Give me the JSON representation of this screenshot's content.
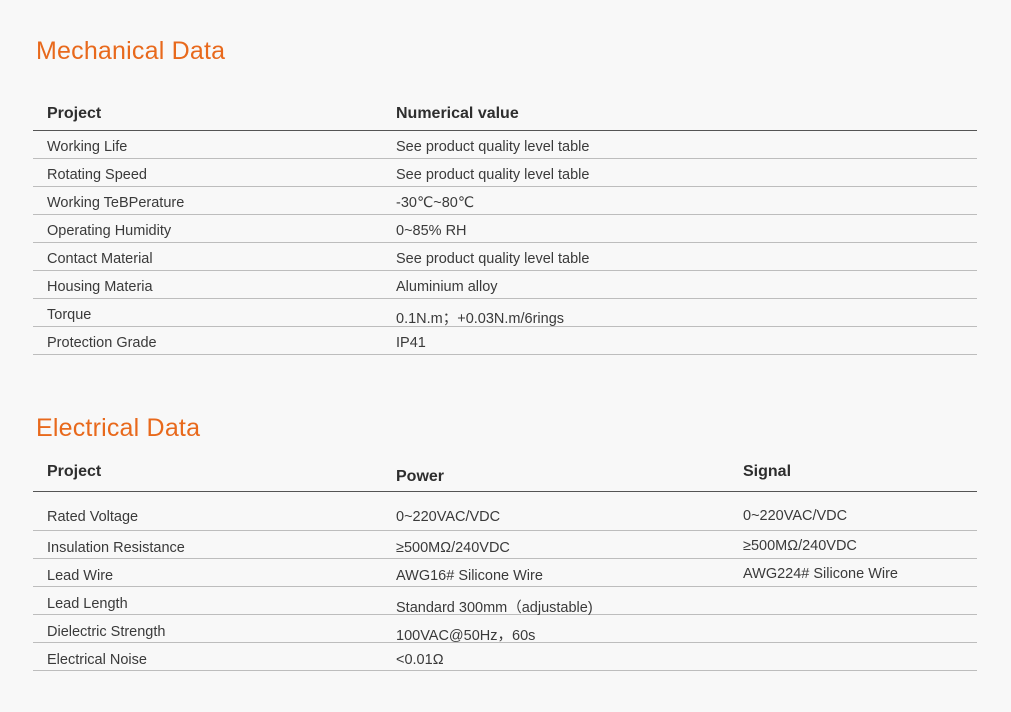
{
  "mechanical": {
    "title": "Mechanical Data",
    "headers": [
      "Project",
      "Numerical value"
    ],
    "rows": [
      [
        "Working Life",
        "See product quality level table"
      ],
      [
        "Rotating Speed",
        "See product quality level table"
      ],
      [
        "Working TeBPerature",
        "-30℃~80℃"
      ],
      [
        "Operating Humidity",
        "0~85% RH"
      ],
      [
        "Contact Material",
        "See product quality level table"
      ],
      [
        "Housing Materia",
        "Aluminium alloy"
      ],
      [
        "Torque",
        "0.1N.m；+0.03N.m/6rings"
      ],
      [
        "Protection Grade",
        "IP41"
      ]
    ]
  },
  "electrical": {
    "title": "Electrical Data",
    "headers": [
      "Project",
      "Power",
      "Signal"
    ],
    "rows": [
      [
        "Rated Voltage",
        "0~220VAC/VDC",
        "0~220VAC/VDC"
      ],
      [
        "Insulation Resistance",
        "≥500MΩ/240VDC",
        "≥500MΩ/240VDC"
      ],
      [
        "Lead Wire",
        "AWG16# Silicone Wire",
        "AWG224# Silicone Wire"
      ],
      [
        "Lead Length",
        "Standard 300mm（adjustable)",
        ""
      ],
      [
        "Dielectric Strength",
        "100VAC@50Hz，60s",
        ""
      ],
      [
        "Electrical Noise",
        "<0.01Ω",
        ""
      ]
    ]
  }
}
